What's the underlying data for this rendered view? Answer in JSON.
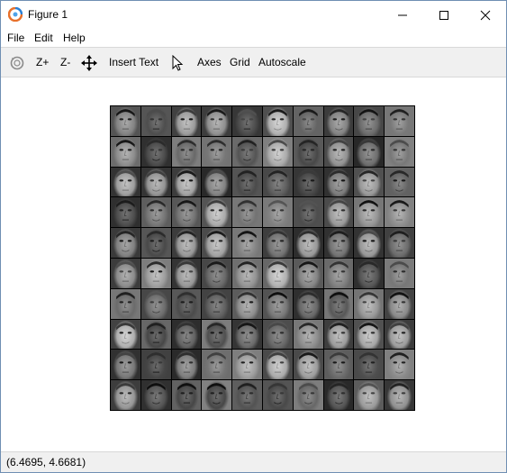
{
  "window": {
    "title": "Figure 1",
    "controls": [
      "minimize",
      "maximize",
      "close"
    ]
  },
  "menu": {
    "items": [
      "File",
      "Edit",
      "Help"
    ]
  },
  "toolbar": {
    "zoom_in": "Z+",
    "zoom_out": "Z-",
    "insert_text": "Insert Text",
    "axes": "Axes",
    "grid": "Grid",
    "autoscale": "Autoscale",
    "icons": [
      "rotate-icon",
      "pan-icon",
      "select-pointer-icon"
    ]
  },
  "figure": {
    "grid_rows": 10,
    "grid_cols": 10
  },
  "status": {
    "coordinates": "(6.4695, 4.6681)"
  }
}
